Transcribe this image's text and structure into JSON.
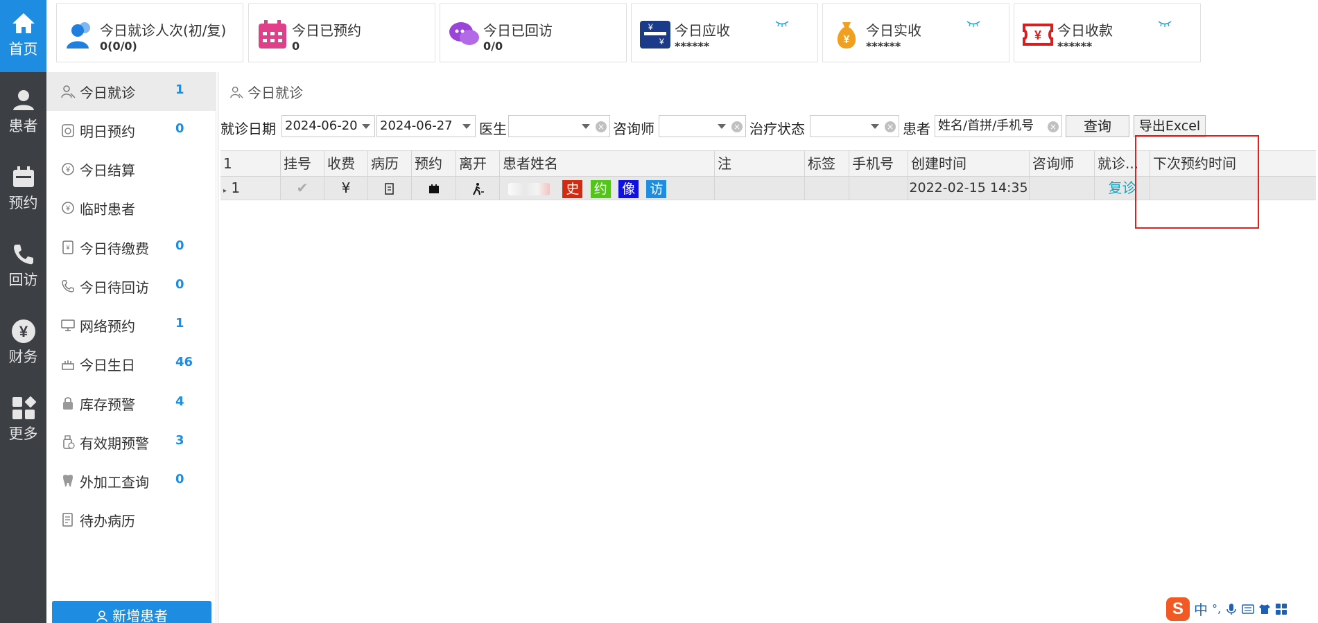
{
  "rail": [
    {
      "label": "首页",
      "icon": "home-icon",
      "active": true
    },
    {
      "label": "患者",
      "icon": "patient-icon",
      "active": false
    },
    {
      "label": "预约",
      "icon": "calendar-icon",
      "active": false
    },
    {
      "label": "回访",
      "icon": "phone-icon",
      "active": false
    },
    {
      "label": "财务",
      "icon": "yen-icon",
      "active": false
    },
    {
      "label": "更多",
      "icon": "apps-icon",
      "active": false
    }
  ],
  "stats": [
    {
      "title": "今日就诊人次(初/复)",
      "value": "0(0/0)",
      "icon": "users-icon",
      "color": "#1e7fe0"
    },
    {
      "title": "今日已预约",
      "value": "0",
      "icon": "calendar-icon",
      "color": "#e0408a"
    },
    {
      "title": "今日已回访",
      "value": "0/0",
      "icon": "chat-icon",
      "color": "#9b44d8"
    },
    {
      "title": "今日应收",
      "value": "******",
      "icon": "receivable-icon",
      "color": "#1b3a8a"
    },
    {
      "title": "今日实收",
      "value": "******",
      "icon": "money-bag-icon",
      "color": "#f0a020"
    },
    {
      "title": "今日收款",
      "value": "******",
      "icon": "ticket-icon",
      "color": "#d42020"
    }
  ],
  "submenu": [
    {
      "label": "今日就诊",
      "count": "1",
      "icon": "visit-icon",
      "active": true
    },
    {
      "label": "明日预约",
      "count": "0",
      "icon": "clock-icon",
      "active": false
    },
    {
      "label": "今日结算",
      "count": "",
      "icon": "yen-circle-icon",
      "active": false
    },
    {
      "label": "临时患者",
      "count": "",
      "icon": "yen-circle-icon",
      "active": false
    },
    {
      "label": "今日待缴费",
      "count": "0",
      "icon": "bill-icon",
      "active": false
    },
    {
      "label": "今日待回访",
      "count": "0",
      "icon": "phone-icon",
      "active": false
    },
    {
      "label": "网络预约",
      "count": "1",
      "icon": "monitor-icon",
      "active": false
    },
    {
      "label": "今日生日",
      "count": "46",
      "icon": "cake-icon",
      "active": false
    },
    {
      "label": "库存预警",
      "count": "4",
      "icon": "lock-icon",
      "active": false
    },
    {
      "label": "有效期预警",
      "count": "3",
      "icon": "bottle-icon",
      "active": false
    },
    {
      "label": "外加工查询",
      "count": "0",
      "icon": "tooth-icon",
      "active": false
    },
    {
      "label": "待办病历",
      "count": "",
      "icon": "record-icon",
      "active": false
    }
  ],
  "add_patient_label": "新增患者",
  "breadcrumb": "今日就诊",
  "filters": {
    "date_label": "就诊日期",
    "date_from": "2024-06-20",
    "date_to": "2024-06-27",
    "doctor_label": "医生",
    "doctor_value": "",
    "consultant_label": "咨询师",
    "consultant_value": "",
    "status_label": "治疗状态",
    "status_value": "",
    "patient_label": "患者",
    "patient_placeholder": "姓名/首拼/手机号",
    "query_label": "查询",
    "export_label": "导出Excel"
  },
  "table": {
    "headers": [
      "1",
      "挂号",
      "收费",
      "病历",
      "预约",
      "离开",
      "患者姓名",
      "注",
      "标签",
      "手机号",
      "创建时间",
      "咨询师",
      "就诊...",
      "下次预约时间"
    ],
    "rows": [
      {
        "index": "1",
        "registered": "✔",
        "charge": "¥",
        "record": "record",
        "appointment": "appointment",
        "leave": "leave",
        "name": "",
        "tags": [
          {
            "text": "史",
            "color": "#d42a10"
          },
          {
            "text": "约",
            "color": "#52c41a"
          },
          {
            "text": "像",
            "color": "#1010e0"
          },
          {
            "text": "访",
            "color": "#1e8ce0"
          }
        ],
        "note": "",
        "label": "",
        "phone": "",
        "created": "2022-02-15 14:35",
        "consultant": "",
        "visit_type": "复诊",
        "next_appointment": ""
      }
    ]
  },
  "ime": {
    "mode": "中",
    "punct": "°,"
  }
}
